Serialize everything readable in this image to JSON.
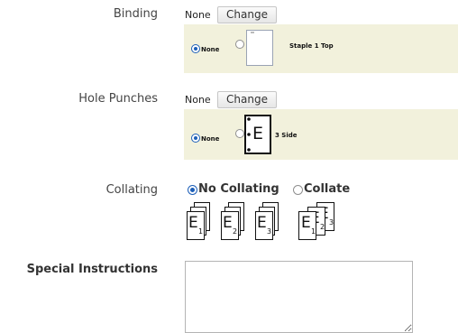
{
  "binding": {
    "label": "Binding",
    "current": "None",
    "change_label": "Change",
    "option_none": "None",
    "option_staple": "Staple 1 Top"
  },
  "hole_punches": {
    "label": "Hole Punches",
    "current": "None",
    "change_label": "Change",
    "option_none": "None",
    "option_side": "3 Side",
    "thumb_letter": "E"
  },
  "collating": {
    "label": "Collating",
    "option_no": "No Collating",
    "option_yes": "Collate",
    "selected": "No Collating",
    "page_letter": "E",
    "page_numbers": [
      "1",
      "2",
      "3"
    ]
  },
  "special_instructions": {
    "label": "Special Instructions",
    "value": ""
  }
}
